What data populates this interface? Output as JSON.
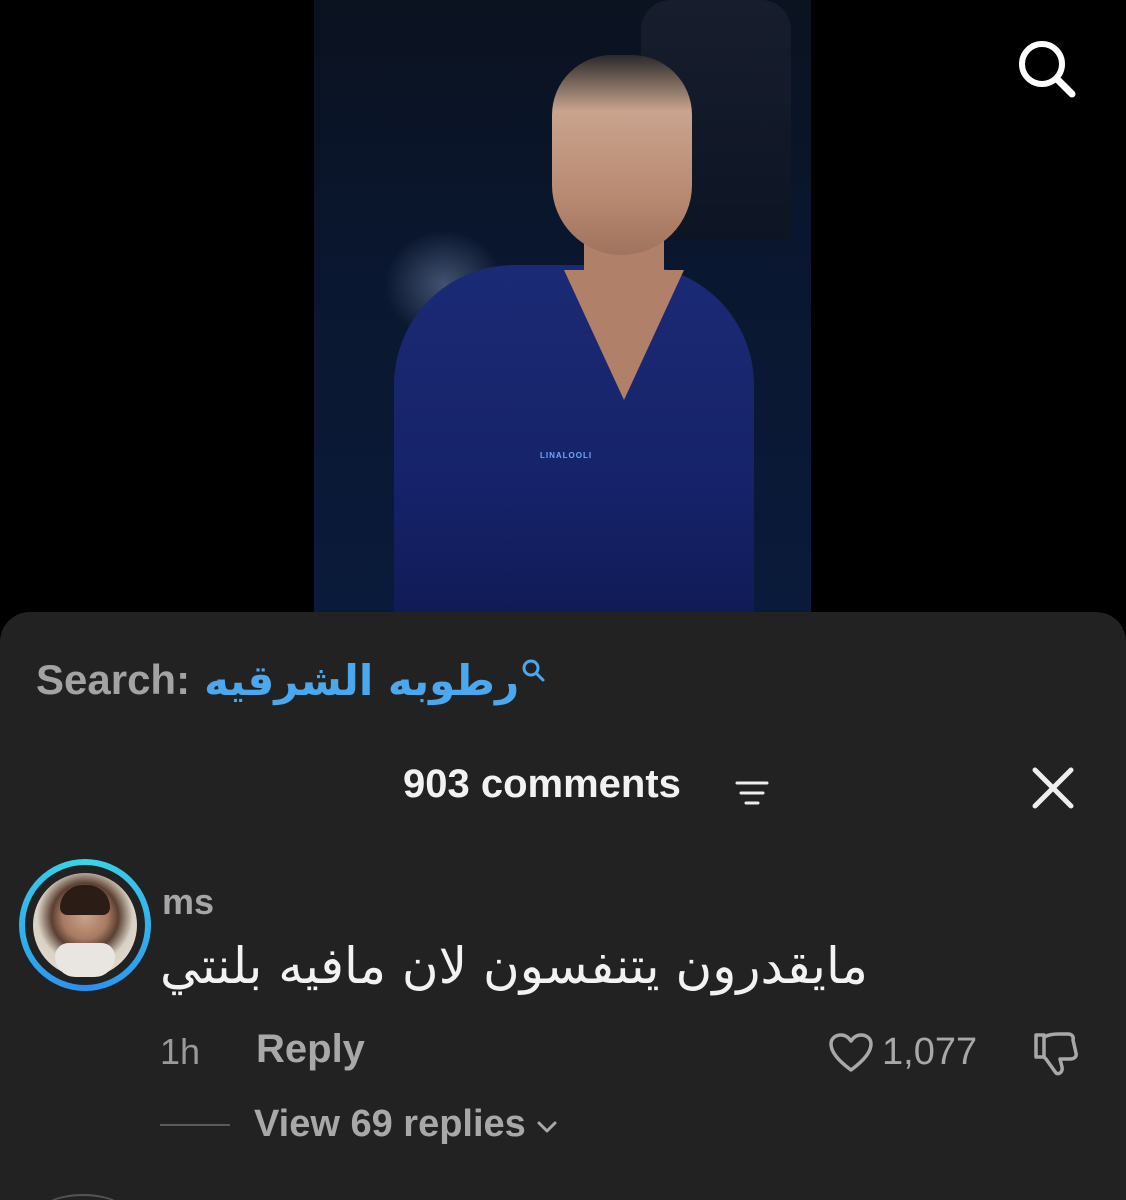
{
  "video": {
    "watermark": "LINALOOLI"
  },
  "top_search": {
    "icon": "search-icon"
  },
  "search_suggestion": {
    "label": "Search:",
    "query": "رطوبه الشرقيه",
    "query_color": "#4ba7ee",
    "icon": "search-icon"
  },
  "comments_header": {
    "count_label": "903 comments",
    "filter_icon": "sort-filter-icon",
    "close_icon": "close-icon"
  },
  "comment": {
    "username": "ms",
    "text": "مايقدرون يتنفسون لان مافيه بلنتي",
    "time": "1h",
    "reply_label": "Reply",
    "like_icon": "heart-icon",
    "like_count": "1,077",
    "dislike_icon": "thumbs-down-icon",
    "view_replies_label": "View 69 replies",
    "avatar_ring_colors": [
      "#3ad6e6",
      "#2a8ff0"
    ]
  },
  "colors": {
    "sheet_background": "#222222",
    "accent_link": "#4ba7ee",
    "muted_text": "#a8a8a8"
  }
}
